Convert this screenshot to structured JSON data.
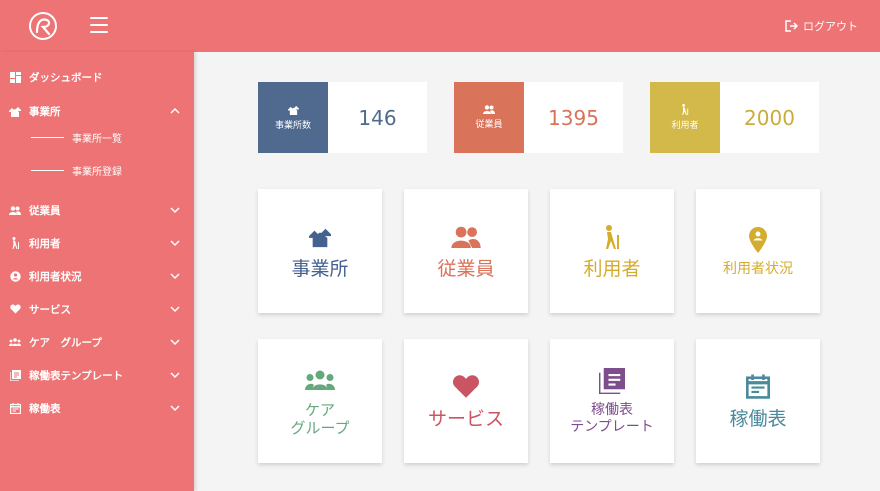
{
  "header": {
    "logout_label": "ログアウト"
  },
  "sidebar": {
    "items": [
      {
        "label": "ダッシュボード",
        "icon": "dashboard-icon"
      },
      {
        "label": "事業所",
        "icon": "office-icon",
        "expanded": true
      },
      {
        "label": "従業員",
        "icon": "people-icon"
      },
      {
        "label": "利用者",
        "icon": "walker-icon"
      },
      {
        "label": "利用者状況",
        "icon": "pin-icon"
      },
      {
        "label": "サービス",
        "icon": "heart-icon"
      },
      {
        "label": "ケア　グループ",
        "icon": "group-icon"
      },
      {
        "label": "稼働表テンプレート",
        "icon": "list-icon"
      },
      {
        "label": "稼働表",
        "icon": "calendar-icon"
      }
    ],
    "subitems": [
      {
        "label": "事業所一覧"
      },
      {
        "label": "事業所登録"
      }
    ]
  },
  "stats": [
    {
      "label": "事業所数",
      "value": "146",
      "color": "#506a8f",
      "text_color": "#506a8f"
    },
    {
      "label": "従業員",
      "value": "1395",
      "color": "#d9735a",
      "text_color": "#d9735a"
    },
    {
      "label": "利用者",
      "value": "2000",
      "color": "#d3b84a",
      "text_color": "#c9ac3c"
    }
  ],
  "cards": [
    {
      "label": "事業所",
      "color": "#44628f",
      "icon": "office-icon"
    },
    {
      "label": "従業員",
      "color": "#d9735a",
      "icon": "people-icon"
    },
    {
      "label": "利用者",
      "color": "#d4ac2e",
      "icon": "walker-icon"
    },
    {
      "label": "利用者状況",
      "color": "#d4ac2e",
      "icon": "pin-icon"
    },
    {
      "label_line1": "ケア",
      "label_line2": "グループ",
      "color": "#66a87e",
      "icon": "group-icon"
    },
    {
      "label": "サービス",
      "color": "#c95562",
      "icon": "heart-icon"
    },
    {
      "label_line1": "稼働表",
      "label_line2": "テンプレート",
      "color": "#7d4d8c",
      "icon": "list-icon"
    },
    {
      "label": "稼働表",
      "color": "#4a8a9a",
      "icon": "calendar-icon"
    }
  ]
}
